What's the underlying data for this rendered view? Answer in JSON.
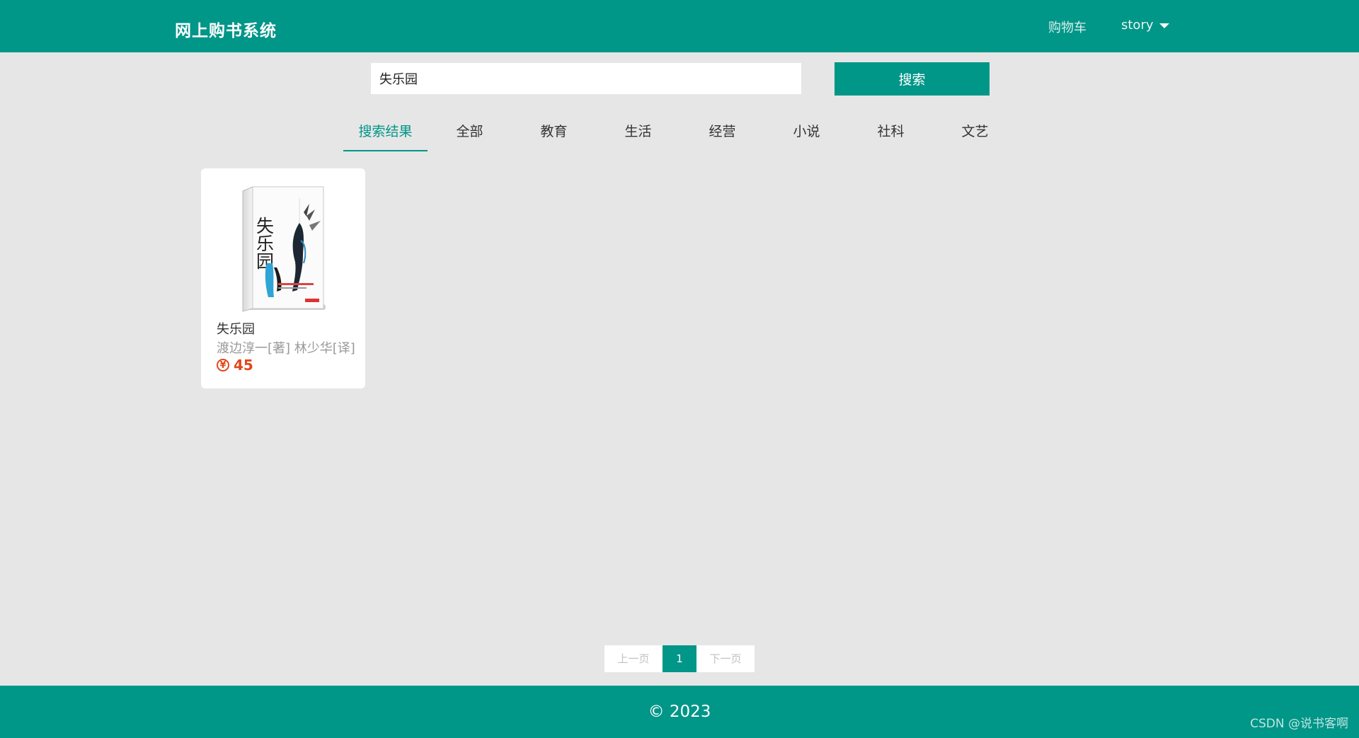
{
  "header": {
    "brand": "网上购书系统",
    "cart_label": "购物车",
    "user_label": "story"
  },
  "search": {
    "value": "失乐园",
    "button_label": "搜索"
  },
  "tabs": [
    {
      "label": "搜索结果",
      "active": true
    },
    {
      "label": "全部",
      "active": false
    },
    {
      "label": "教育",
      "active": false
    },
    {
      "label": "生活",
      "active": false
    },
    {
      "label": "经营",
      "active": false
    },
    {
      "label": "小说",
      "active": false
    },
    {
      "label": "社科",
      "active": false
    },
    {
      "label": "文艺",
      "active": false
    }
  ],
  "results": [
    {
      "title": "失乐园",
      "author": "渡边淳一[著] 林少华[译]",
      "price": "45",
      "currency_symbol": "¥",
      "cover_text": "失乐园"
    }
  ],
  "pagination": {
    "prev_label": "上一页",
    "current_page": "1",
    "next_label": "下一页"
  },
  "footer": {
    "copyright": "© 2023"
  },
  "watermark": "CSDN @说书客啊",
  "colors": {
    "primary": "#009688",
    "background": "#e6e6e6",
    "price": "#e2471b"
  }
}
